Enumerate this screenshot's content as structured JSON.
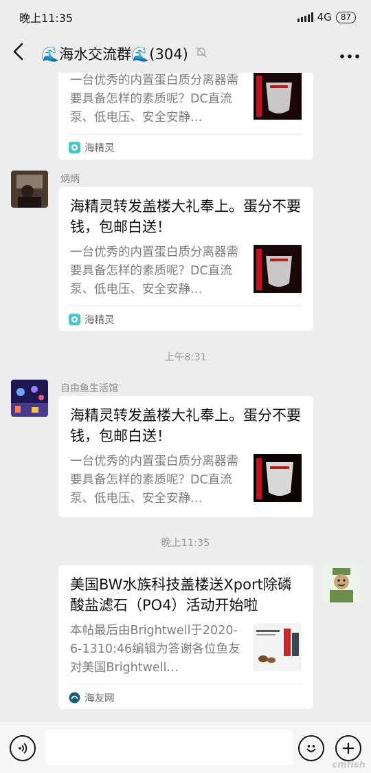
{
  "status_bar": {
    "time": "晚上11:35",
    "network": "4G",
    "battery": "87"
  },
  "nav": {
    "title": "🌊海水交流群🌊(304)"
  },
  "messages": [
    {
      "desc": "一台优秀的内置蛋白质分离器需要具备怎样的素质呢？DC直流泵、低电压、安全安静…",
      "source": "海精灵"
    },
    {
      "sender": "炳炳",
      "title": "海精灵转发盖楼大礼奉上。蛋分不要钱，包邮白送！",
      "desc": "一台优秀的内置蛋白质分离器需要具备怎样的素质呢？DC直流泵、低电压、安全安静…",
      "source": "海精灵"
    },
    {
      "time": "上午8:31"
    },
    {
      "sender": "自由鱼生活馆",
      "title": "海精灵转发盖楼大礼奉上。蛋分不要钱，包邮白送！",
      "desc": "一台优秀的内置蛋白质分离器需要具备怎样的素质呢？DC直流泵、低电压、安全安静…"
    },
    {
      "time": "晚上11:35"
    },
    {
      "title": "美国BW水族科技盖楼送Xport除磷酸盐滤石（PO4）活动开始啦",
      "desc": "本帖最后由Brightwell于2020-6-1310:46编辑为答谢各位鱼友对美国Brightwell…",
      "source": "海友网"
    }
  ],
  "input_bar": {
    "placeholder": ""
  },
  "watermark": "cmfish"
}
